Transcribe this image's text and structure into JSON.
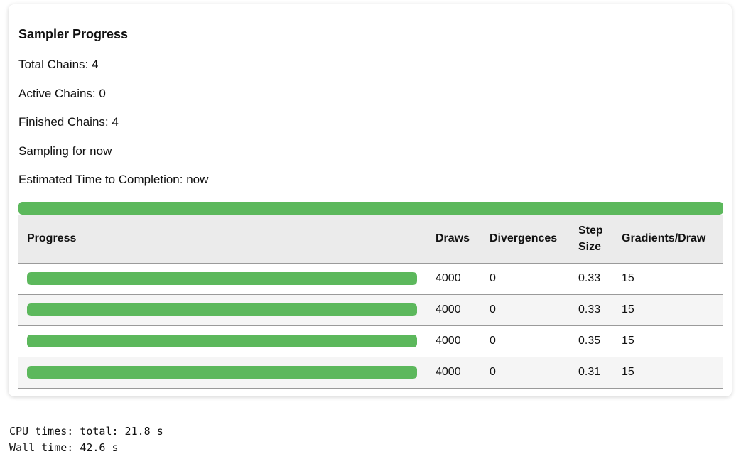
{
  "sampler": {
    "title": "Sampler Progress",
    "total_chains": "Total Chains: 4",
    "active_chains": "Active Chains: 0",
    "finished_chains": "Finished Chains: 4",
    "sampling_for": "Sampling for now",
    "eta": "Estimated Time to Completion: now",
    "overall_progress": 1.0,
    "bar_color": "#5cb85c",
    "bar_track_color": "#e5e5e5"
  },
  "table": {
    "headers": {
      "progress": "Progress",
      "draws": "Draws",
      "divergences": "Divergences",
      "step_size": "Step Size",
      "gradients": "Gradients/Draw"
    },
    "rows": [
      {
        "progress": 1.0,
        "draws": "4000",
        "divergences": "0",
        "step_size": "0.33",
        "gradients": "15"
      },
      {
        "progress": 1.0,
        "draws": "4000",
        "divergences": "0",
        "step_size": "0.33",
        "gradients": "15"
      },
      {
        "progress": 1.0,
        "draws": "4000",
        "divergences": "0",
        "step_size": "0.35",
        "gradients": "15"
      },
      {
        "progress": 1.0,
        "draws": "4000",
        "divergences": "0",
        "step_size": "0.31",
        "gradients": "15"
      }
    ]
  },
  "output": {
    "cpu_times": "CPU times: total: 21.8 s",
    "wall_time": "Wall time: 42.6 s"
  }
}
